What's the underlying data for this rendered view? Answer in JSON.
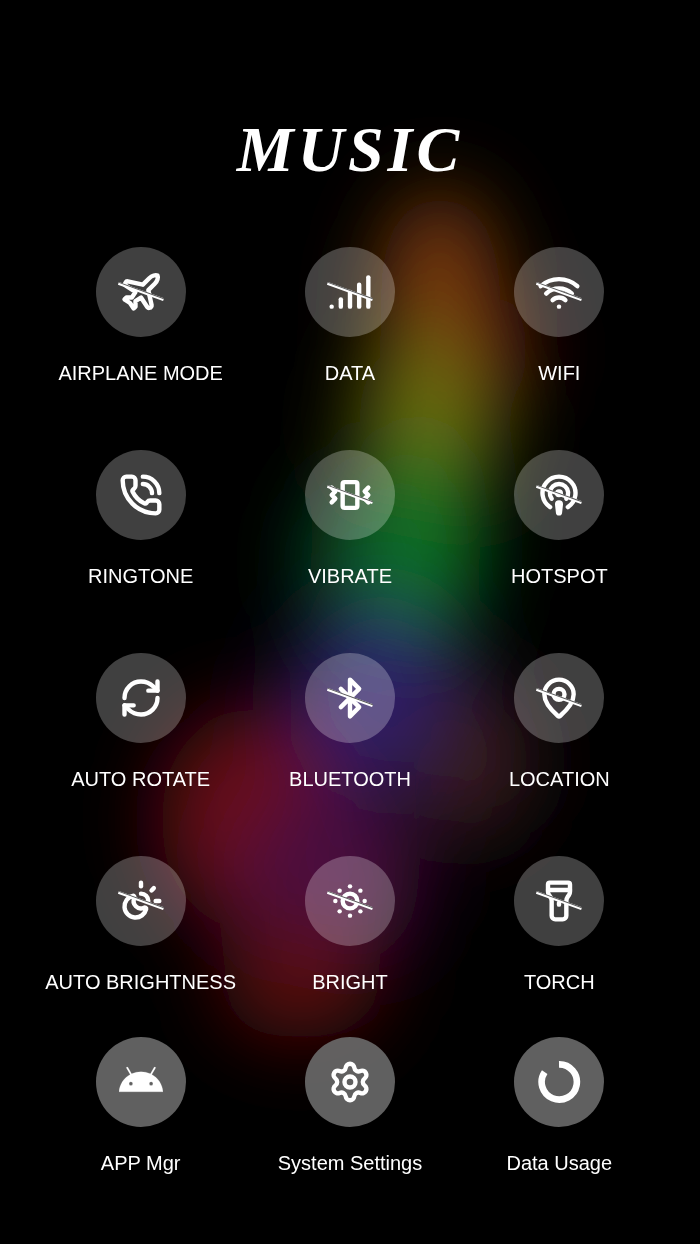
{
  "title": "MUSIC",
  "tiles": [
    {
      "kind": "toggle",
      "label": "AIRPLANE MODE",
      "on": false
    },
    {
      "kind": "toggle",
      "label": "DATA",
      "on": false
    },
    {
      "kind": "toggle",
      "label": "WIFI",
      "on": false
    },
    {
      "kind": "toggle",
      "label": "RINGTONE",
      "on": true
    },
    {
      "kind": "toggle",
      "label": "VIBRATE",
      "on": false
    },
    {
      "kind": "toggle",
      "label": "HOTSPOT",
      "on": false
    },
    {
      "kind": "toggle",
      "label": "AUTO ROTATE",
      "on": true
    },
    {
      "kind": "toggle",
      "label": "BLUETOOTH",
      "on": false
    },
    {
      "kind": "toggle",
      "label": "LOCATION",
      "on": false
    },
    {
      "kind": "toggle",
      "label": "AUTO BRIGHTNESS",
      "on": false
    },
    {
      "kind": "toggle",
      "label": "BRIGHT",
      "on": false
    },
    {
      "kind": "toggle",
      "label": "TORCH",
      "on": false
    },
    {
      "kind": "shortcut",
      "label": "APP Mgr"
    },
    {
      "kind": "shortcut",
      "label": "System Settings"
    },
    {
      "kind": "shortcut",
      "label": "Data Usage"
    }
  ]
}
